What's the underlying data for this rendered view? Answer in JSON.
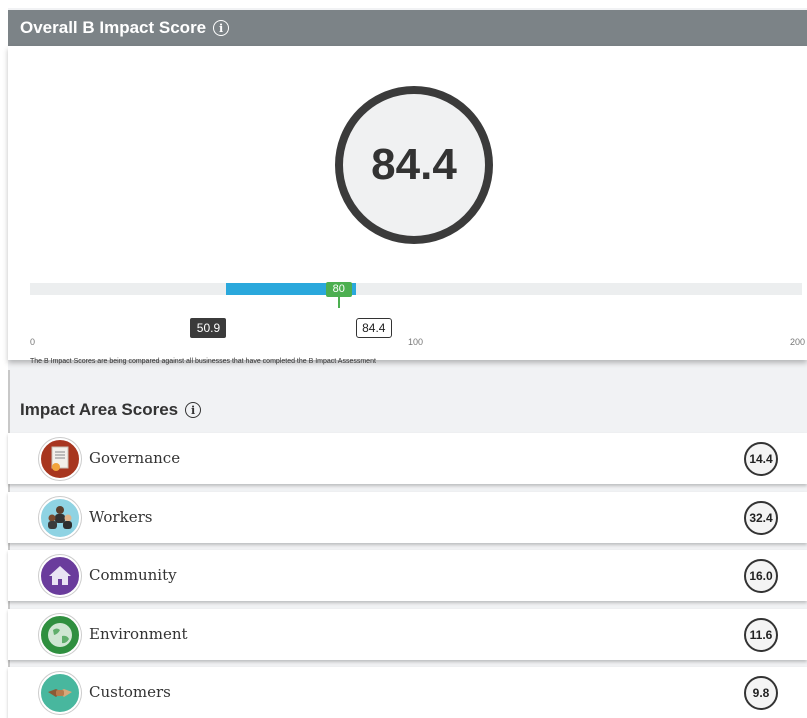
{
  "overall": {
    "title": "Overall B Impact Score",
    "info_glyph": "i",
    "score": "84.4",
    "scale": {
      "min_label": "0",
      "mid_label": "100",
      "max_label": "200",
      "min": 0,
      "max": 200,
      "median_label": "80",
      "median": 80,
      "range_low_label": "50.9",
      "range_low": 50.9,
      "range_high_label": "84.4",
      "range_high": 84.4
    },
    "note": "The B Impact Scores are being compared against all businesses that have completed the B Impact Assessment"
  },
  "areas": {
    "title": "Impact Area Scores",
    "info_glyph": "i",
    "items": [
      {
        "name": "Governance",
        "score": "14.4",
        "icon": "governance-document-icon",
        "color": "#a8361f"
      },
      {
        "name": "Workers",
        "score": "32.4",
        "icon": "workers-people-icon",
        "color": "#8fd3e3"
      },
      {
        "name": "Community",
        "score": "16.0",
        "icon": "community-house-icon",
        "color": "#6a3c9c"
      },
      {
        "name": "Environment",
        "score": "11.6",
        "icon": "environment-globe-icon",
        "color": "#2f8f3f"
      },
      {
        "name": "Customers",
        "score": "9.8",
        "icon": "customers-handshake-icon",
        "color": "#48b79e"
      }
    ]
  },
  "colors": {
    "header_bg": "#7c8387",
    "range_bar": "#2aa8dc",
    "median_marker": "#4caf50"
  }
}
